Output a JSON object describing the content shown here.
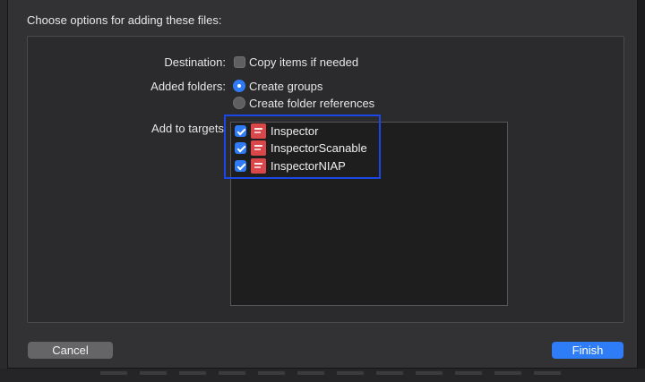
{
  "dialog": {
    "title": "Choose options for adding these files:"
  },
  "destination": {
    "label": "Destination:",
    "copy_items": {
      "label": "Copy items if needed",
      "checked": false
    }
  },
  "added_folders": {
    "label": "Added folders:",
    "options": [
      {
        "label": "Create groups",
        "selected": true
      },
      {
        "label": "Create folder references",
        "selected": false
      }
    ]
  },
  "targets": {
    "label": "Add to targets",
    "items": [
      {
        "name": "Inspector",
        "checked": true
      },
      {
        "name": "InspectorScanable",
        "checked": true
      },
      {
        "name": "InspectorNIAP",
        "checked": true
      }
    ]
  },
  "buttons": {
    "cancel": "Cancel",
    "finish": "Finish"
  },
  "colors": {
    "accent": "#2e7cf6",
    "highlight_box": "#1a47e6",
    "app_icon": "#d9474b"
  }
}
